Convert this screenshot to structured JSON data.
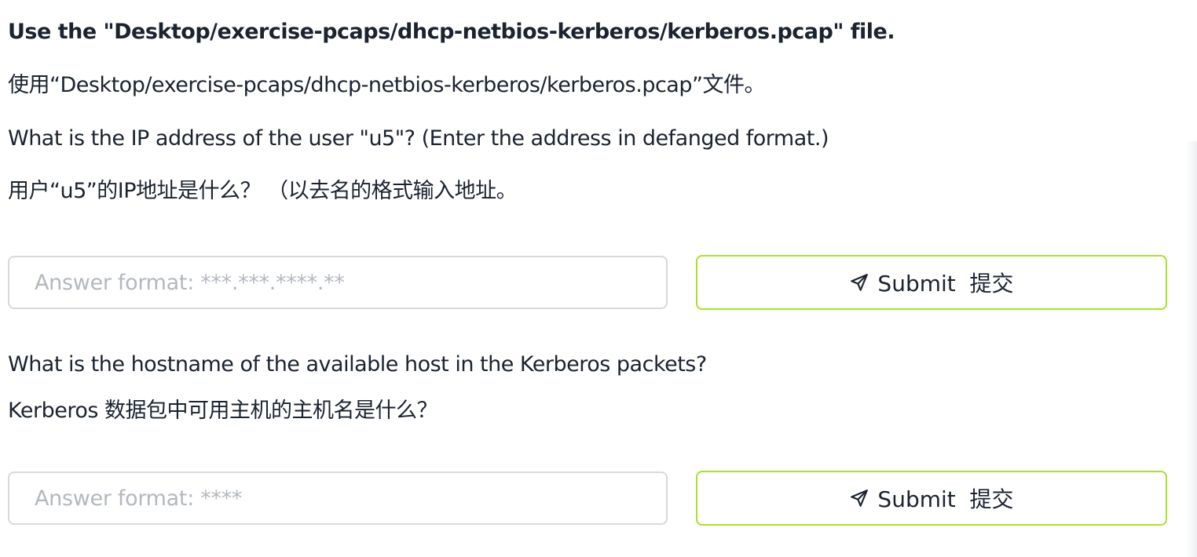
{
  "instruction": {
    "en": "Use the \"Desktop/exercise-pcaps/dhcp-netbios-kerberos/kerberos.pcap\" file.",
    "zh": "使用“Desktop/exercise-pcaps/dhcp-netbios-kerberos/kerberos.pcap”文件。"
  },
  "questions": [
    {
      "en": "What is the IP address of the user \"u5\"? (Enter the address in defanged format.)",
      "zh": "用户“u5”的IP地址是什么？ （以去名的格式输入地址。",
      "placeholder": "Answer format: ***.***.****.**",
      "submit_label": "Submit  提交"
    },
    {
      "en": "What is the hostname of the available host in the Kerberos packets?",
      "zh": "Kerberos 数据包中可用主机的主机名是什么？",
      "placeholder": "Answer format: ****",
      "submit_label": "Submit  提交"
    }
  ],
  "icons": {
    "submit": "paper-plane-icon"
  },
  "colors": {
    "text": "#1b2330",
    "submit_border": "#a6e22e",
    "input_border": "#d6d9de",
    "placeholder": "#b3b8c0"
  }
}
